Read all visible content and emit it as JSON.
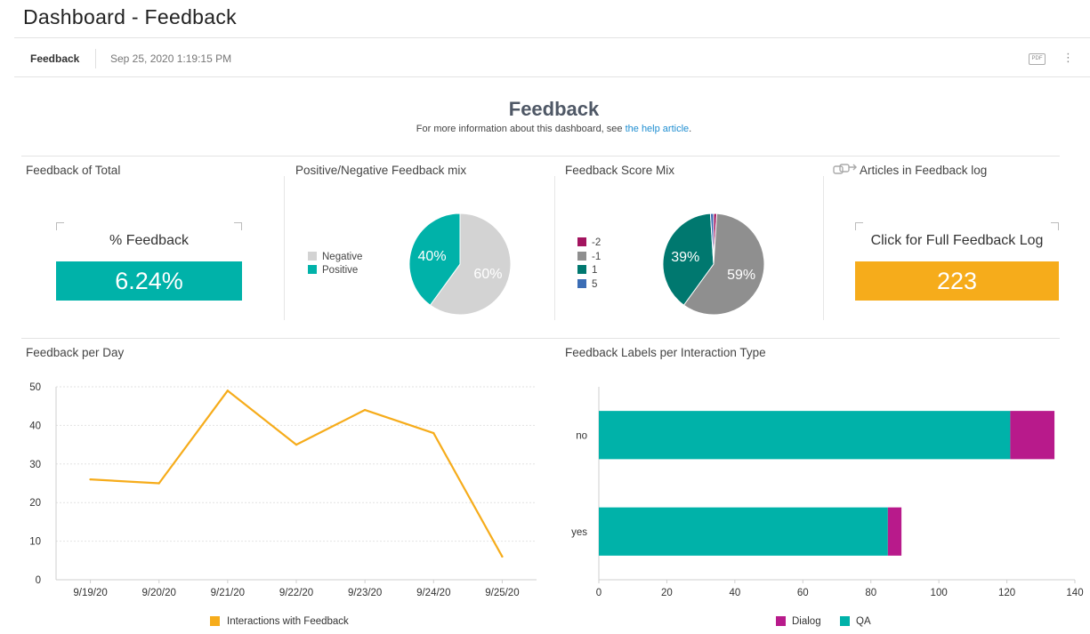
{
  "page": {
    "title": "Dashboard - Feedback",
    "tab_name": "Feedback",
    "timestamp": "Sep 25, 2020 1:19:15 PM",
    "pdf_label": "PDF",
    "menu_icon": "more-vert-icon",
    "heading": "Feedback",
    "subtitle_prefix": "For more information about this dashboard, see ",
    "help_link": "the help article",
    "subtitle_suffix": "."
  },
  "sections": {
    "feedback_of_total": "Feedback of Total",
    "posneg_mix": "Positive/Negative Feedback mix",
    "score_mix": "Feedback Score Mix",
    "articles_log": "Articles in Feedback log",
    "per_day": "Feedback per Day",
    "labels_per_type": "Feedback Labels per Interaction Type"
  },
  "kpis": {
    "pct_label": "% Feedback",
    "pct_value": "6.24%",
    "log_label": "Click for Full Feedback Log",
    "log_value": "223"
  },
  "colors": {
    "teal": "#00b2a9",
    "dark_teal": "#00786f",
    "grey": "#8f8f8f",
    "light_grey": "#d3d3d3",
    "magenta": "#b81a8b",
    "orange": "#f6ac1b",
    "blue": "#3b6db5"
  },
  "chart_data": [
    {
      "type": "pie",
      "title": "Positive/Negative Feedback mix",
      "slices": [
        {
          "label": "Negative",
          "value": 60,
          "display": "60%",
          "color": "#d3d3d3"
        },
        {
          "label": "Positive",
          "value": 40,
          "display": "40%",
          "color": "#00b2a9"
        }
      ]
    },
    {
      "type": "pie",
      "title": "Feedback Score Mix",
      "slices": [
        {
          "label": "-2",
          "value": 1,
          "display": "",
          "color": "#a3145f"
        },
        {
          "label": "-1",
          "value": 59,
          "display": "59%",
          "color": "#8f8f8f"
        },
        {
          "label": "1",
          "value": 39,
          "display": "39%",
          "color": "#00786f"
        },
        {
          "label": "5",
          "value": 1,
          "display": "",
          "color": "#3b6db5"
        }
      ]
    },
    {
      "type": "line",
      "title": "Feedback per Day",
      "categories": [
        "9/19/20",
        "9/20/20",
        "9/21/20",
        "9/22/20",
        "9/23/20",
        "9/24/20",
        "9/25/20"
      ],
      "series": [
        {
          "name": "Interactions with Feedback",
          "values": [
            26,
            25,
            49,
            35,
            44,
            38,
            6
          ],
          "color": "#f6ac1b"
        }
      ],
      "ylim": [
        0,
        50
      ],
      "yticks": [
        0,
        10,
        20,
        30,
        40,
        50
      ],
      "grid": true,
      "legend": "bottom"
    },
    {
      "type": "bar",
      "orientation": "horizontal",
      "stacked": true,
      "title": "Feedback Labels per Interaction Type",
      "categories": [
        "no",
        "yes"
      ],
      "series": [
        {
          "name": "QA",
          "values": [
            121,
            85
          ],
          "color": "#00b2a9"
        },
        {
          "name": "Dialog",
          "values": [
            13,
            4
          ],
          "color": "#b81a8b"
        }
      ],
      "legend_order": [
        "Dialog",
        "QA"
      ],
      "xlim": [
        0,
        140
      ],
      "xticks": [
        0,
        20,
        40,
        60,
        80,
        100,
        120,
        140
      ],
      "legend": "bottom"
    }
  ]
}
